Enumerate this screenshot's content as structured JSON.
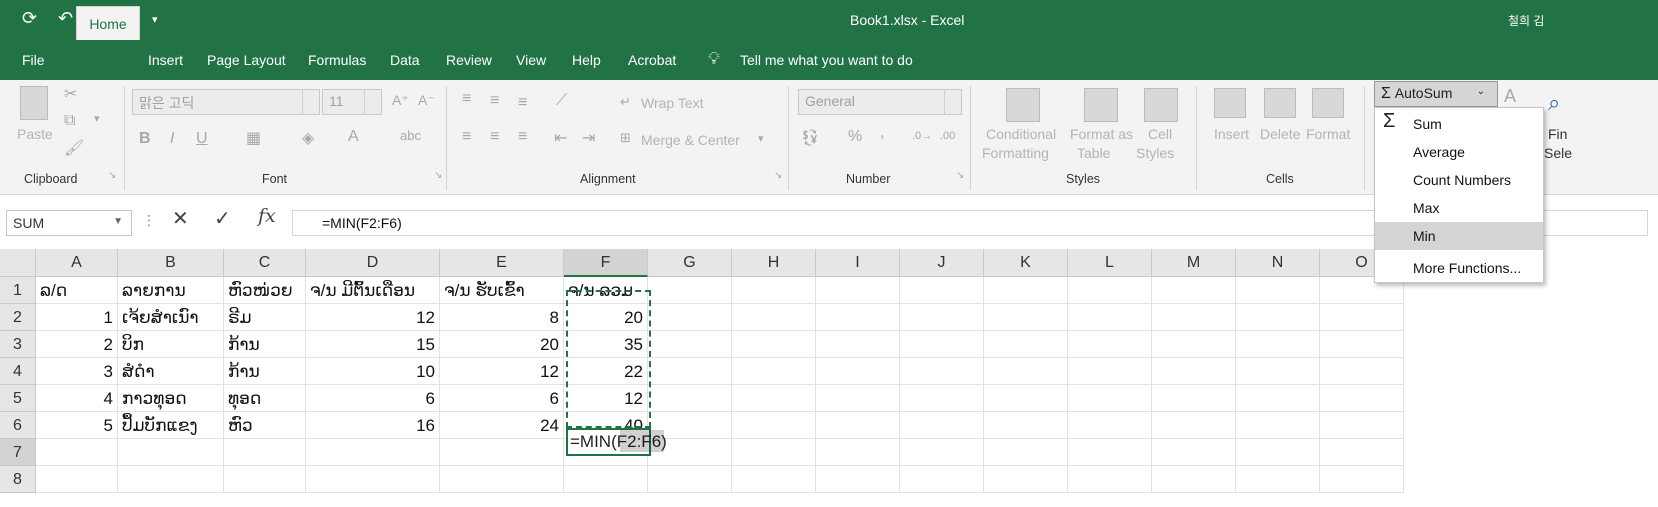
{
  "window": {
    "file_name": "Book1.xlsx",
    "separator": "-",
    "app_name": "Excel",
    "user": "철희 김"
  },
  "tabs": [
    "File",
    "Home",
    "Insert",
    "Page Layout",
    "Formulas",
    "Data",
    "Review",
    "View",
    "Help",
    "Acrobat"
  ],
  "tell_me": "Tell me what you want to do",
  "ribbon": {
    "clipboard": {
      "paste": "Paste",
      "label": "Clipboard"
    },
    "font": {
      "name": "맑은 고딕",
      "size": "11",
      "label": "Font",
      "bold": "B",
      "italic": "I",
      "underline": "U"
    },
    "alignment": {
      "wrap": "Wrap Text",
      "merge": "Merge & Center",
      "label": "Alignment"
    },
    "number": {
      "format": "General",
      "percent": "%",
      "comma": ",",
      "label": "Number"
    },
    "styles": {
      "conditional": [
        "Conditional",
        "Formatting"
      ],
      "format_table": [
        "Format as",
        "Table"
      ],
      "cell_styles": [
        "Cell",
        "Styles"
      ],
      "label": "Styles"
    },
    "cells": {
      "insert": "Insert",
      "delete": "Delete",
      "format": "Format",
      "label": "Cells"
    },
    "editing": {
      "autosum": "AutoSum",
      "find_partial": [
        "Fin",
        "Sele"
      ]
    }
  },
  "formula_bar": {
    "name_box": "SUM",
    "fx": "fx",
    "formula": "=MIN(F2:F6)"
  },
  "columns": [
    "A",
    "B",
    "C",
    "D",
    "E",
    "F",
    "G",
    "H",
    "I",
    "J",
    "K",
    "L",
    "M",
    "N",
    "O"
  ],
  "rows": [
    "1",
    "2",
    "3",
    "4",
    "5",
    "6",
    "7",
    "8"
  ],
  "table": {
    "headers": [
      "ລ/ດ",
      "ລາຍການ",
      "ຫົວໜ່ວຍ",
      "ຈ/ນ ມີຕົ້ນເດືອນ",
      "ຈ/ນ ຮັບເຂົ້າ",
      "ຈ/ນ ລວມ"
    ],
    "rows": [
      [
        "1",
        "ເຈ້ຍສຳເນົາ",
        "ຣີມ",
        "12",
        "8",
        "20"
      ],
      [
        "2",
        "ບິກ",
        "ກ້ານ",
        "15",
        "20",
        "35"
      ],
      [
        "3",
        "ສໍດຳ",
        "ກ້ານ",
        "10",
        "12",
        "22"
      ],
      [
        "4",
        "ກາວທຸອດ",
        "ທຸອດ",
        "6",
        "6",
        "12"
      ],
      [
        "5",
        "ປຶ້ມບັກແຂງ",
        "ຫົວ",
        "16",
        "24",
        "40"
      ]
    ],
    "editing_cell": "=MIN(F2:F6)"
  },
  "autosum_menu": [
    "Sum",
    "Average",
    "Count Numbers",
    "Max",
    "Min",
    "More Functions..."
  ],
  "colors": {
    "excel_green": "#217346",
    "selected": "#d4d4d4"
  }
}
